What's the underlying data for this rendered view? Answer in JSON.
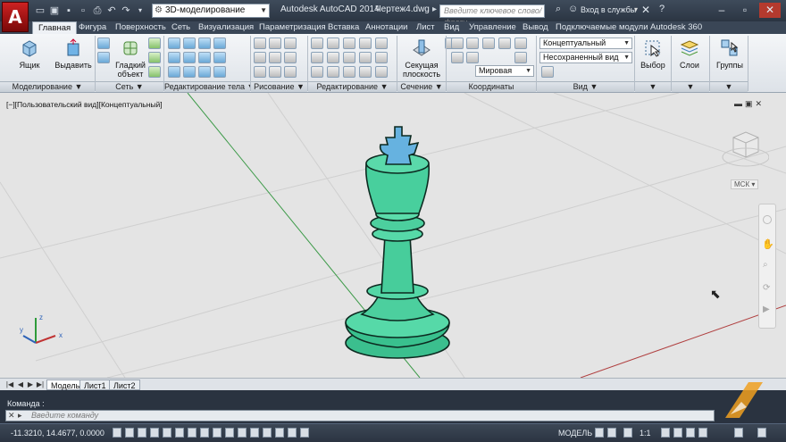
{
  "titlebar": {
    "app_title": "Autodesk AutoCAD 2014",
    "document": "Чертеж4.dwg",
    "workspace": "3D-моделирование",
    "search_placeholder": "Введите ключевое слово/фразу",
    "signin": "Вход в службы"
  },
  "tabs": [
    "Главная",
    "Фигура",
    "Поверхность",
    "Сеть",
    "Визуализация",
    "Параметризация",
    "Вставка",
    "Аннотации",
    "Лист",
    "Вид",
    "Управление",
    "Вывод",
    "Подключаемые модули",
    "Autodesk 360"
  ],
  "ribbon": {
    "buttons": {
      "box": "Ящик",
      "extrude": "Выдавить",
      "smooth": "Гладкий объект",
      "section_plane": "Секущая плоскость",
      "select": "Выбор",
      "layers": "Слои",
      "groups": "Группы"
    },
    "panels": [
      "Моделирование",
      "Сеть",
      "Редактирование тела",
      "Рисование",
      "Редактирование",
      "Сечение",
      "Координаты",
      "Вид"
    ],
    "combos": {
      "visual_style": "Концептуальный",
      "named_view": "Несохраненный вид",
      "ucs": "Мировая"
    }
  },
  "viewport": {
    "label": "[−][Пользовательский вид][Концептуальный]",
    "wcs": "МСК"
  },
  "layout_tabs": [
    "Модель",
    "Лист1",
    "Лист2"
  ],
  "command": {
    "history": "Команда :",
    "placeholder": "Введите команду"
  },
  "status": {
    "coords": "-11.3210, 14.4677, 0.0000",
    "model": "МОДЕЛЬ",
    "scale": "1:1"
  },
  "colors": {
    "titlebar": "#2b3542",
    "viewport": "#e4e4e4",
    "model_fill": "#4cd6a6",
    "accent_red": "#b43a2e"
  }
}
